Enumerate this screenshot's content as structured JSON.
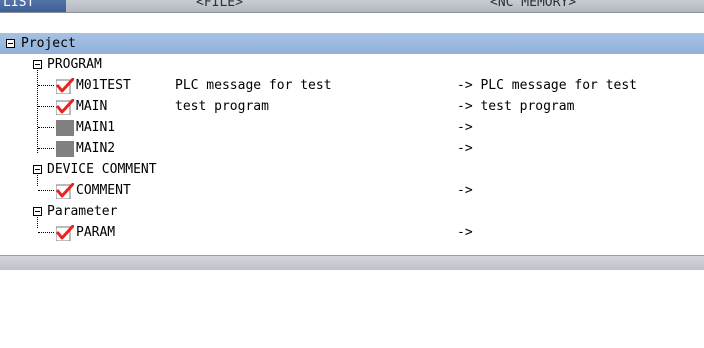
{
  "header": {
    "tab_label": "LIST",
    "col_file": "<FILE>",
    "col_nc_memory": "<NC MEMORY>"
  },
  "tree": {
    "project": "Project",
    "program_group": "PROGRAM",
    "programs": [
      {
        "name": "M01TEST",
        "comment": "PLC message for test",
        "nc": "-> PLC message for test",
        "checked": true
      },
      {
        "name": "MAIN",
        "comment": "test program",
        "nc": "-> test program",
        "checked": true
      },
      {
        "name": "MAIN1",
        "comment": "",
        "nc": "->",
        "checked": false
      },
      {
        "name": "MAIN2",
        "comment": "",
        "nc": "->",
        "checked": false
      }
    ],
    "device_comment_group": "DEVICE COMMENT",
    "comment_item": {
      "name": "COMMENT",
      "nc": "->",
      "checked": true
    },
    "parameter_group": "Parameter",
    "param_item": {
      "name": "PARAM",
      "nc": "->",
      "checked": true
    }
  },
  "colors": {
    "selection": "#99b8de",
    "check": "#e8231f",
    "unchecked_box": "#808080"
  }
}
